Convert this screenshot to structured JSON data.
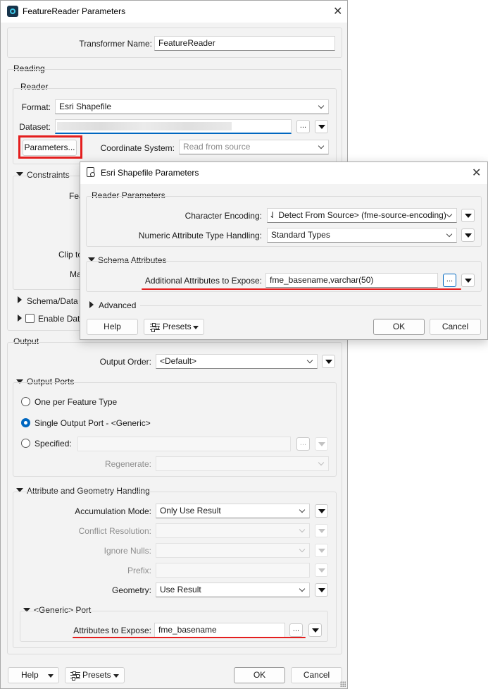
{
  "main_dialog": {
    "title": "FeatureReader Parameters",
    "transformer_name_label": "Transformer Name:",
    "transformer_name_value": "FeatureReader",
    "reading": {
      "group_label": "Reading",
      "reader": {
        "group_label": "Reader",
        "format_label": "Format:",
        "format_value": "Esri Shapefile",
        "dataset_label": "Dataset:",
        "dataset_value": "",
        "parameters_button": "Parameters...",
        "coord_system_label": "Coordinate System:",
        "coord_system_placeholder": "Read from source"
      },
      "constraints_label": "Constraints",
      "constraints_partial_labels": [
        "Fea",
        "Clip to",
        "Ma"
      ],
      "schema_data_label": "Schema/Data I",
      "enable_data_label": "Enable Data"
    },
    "output": {
      "group_label": "Output",
      "output_order_label": "Output Order:",
      "output_order_value": "<Default>",
      "output_ports": {
        "label": "Output Ports",
        "options": [
          "One per Feature Type",
          "Single Output Port - <Generic>",
          "Specified:"
        ],
        "selected": "Single Output Port - <Generic>",
        "regenerate_label": "Regenerate:"
      },
      "attr_geom": {
        "label": "Attribute and Geometry Handling",
        "accumulation_mode_label": "Accumulation Mode:",
        "accumulation_mode_value": "Only Use Result",
        "conflict_resolution_label": "Conflict Resolution:",
        "ignore_nulls_label": "Ignore Nulls:",
        "prefix_label": "Prefix:",
        "geometry_label": "Geometry:",
        "geometry_value": "Use Result",
        "generic_port": {
          "label": "<Generic> Port",
          "attributes_to_expose_label": "Attributes to Expose:",
          "attributes_to_expose_value": "fme_basename"
        }
      }
    },
    "footer": {
      "help": "Help",
      "presets": "Presets",
      "ok": "OK",
      "cancel": "Cancel"
    }
  },
  "sub_dialog": {
    "title": "Esri Shapefile Parameters",
    "reader_params_label": "Reader Parameters",
    "char_encoding_label": "Character Encoding:",
    "char_encoding_value": "⇃ Detect From Source> (fme-source-encoding)",
    "numeric_handling_label": "Numeric Attribute Type Handling:",
    "numeric_handling_value": "Standard Types",
    "schema_attributes_label": "Schema Attributes",
    "additional_attrs_label": "Additional Attributes to Expose:",
    "additional_attrs_value": "fme_basename,varchar(50)",
    "advanced_label": "Advanced",
    "footer": {
      "help": "Help",
      "presets": "Presets",
      "ok": "OK",
      "cancel": "Cancel"
    }
  },
  "colors": {
    "highlight_red": "#e41e1e",
    "accent_blue": "#0067c0",
    "dialog_bg": "#f3f3f3"
  },
  "icons": [
    "app-icon",
    "close-icon",
    "document-settings-icon",
    "presets-icon",
    "chevron-down-icon",
    "dropdown-triangle-icon",
    "expand-triangle-icon",
    "collapse-triangle-icon"
  ]
}
